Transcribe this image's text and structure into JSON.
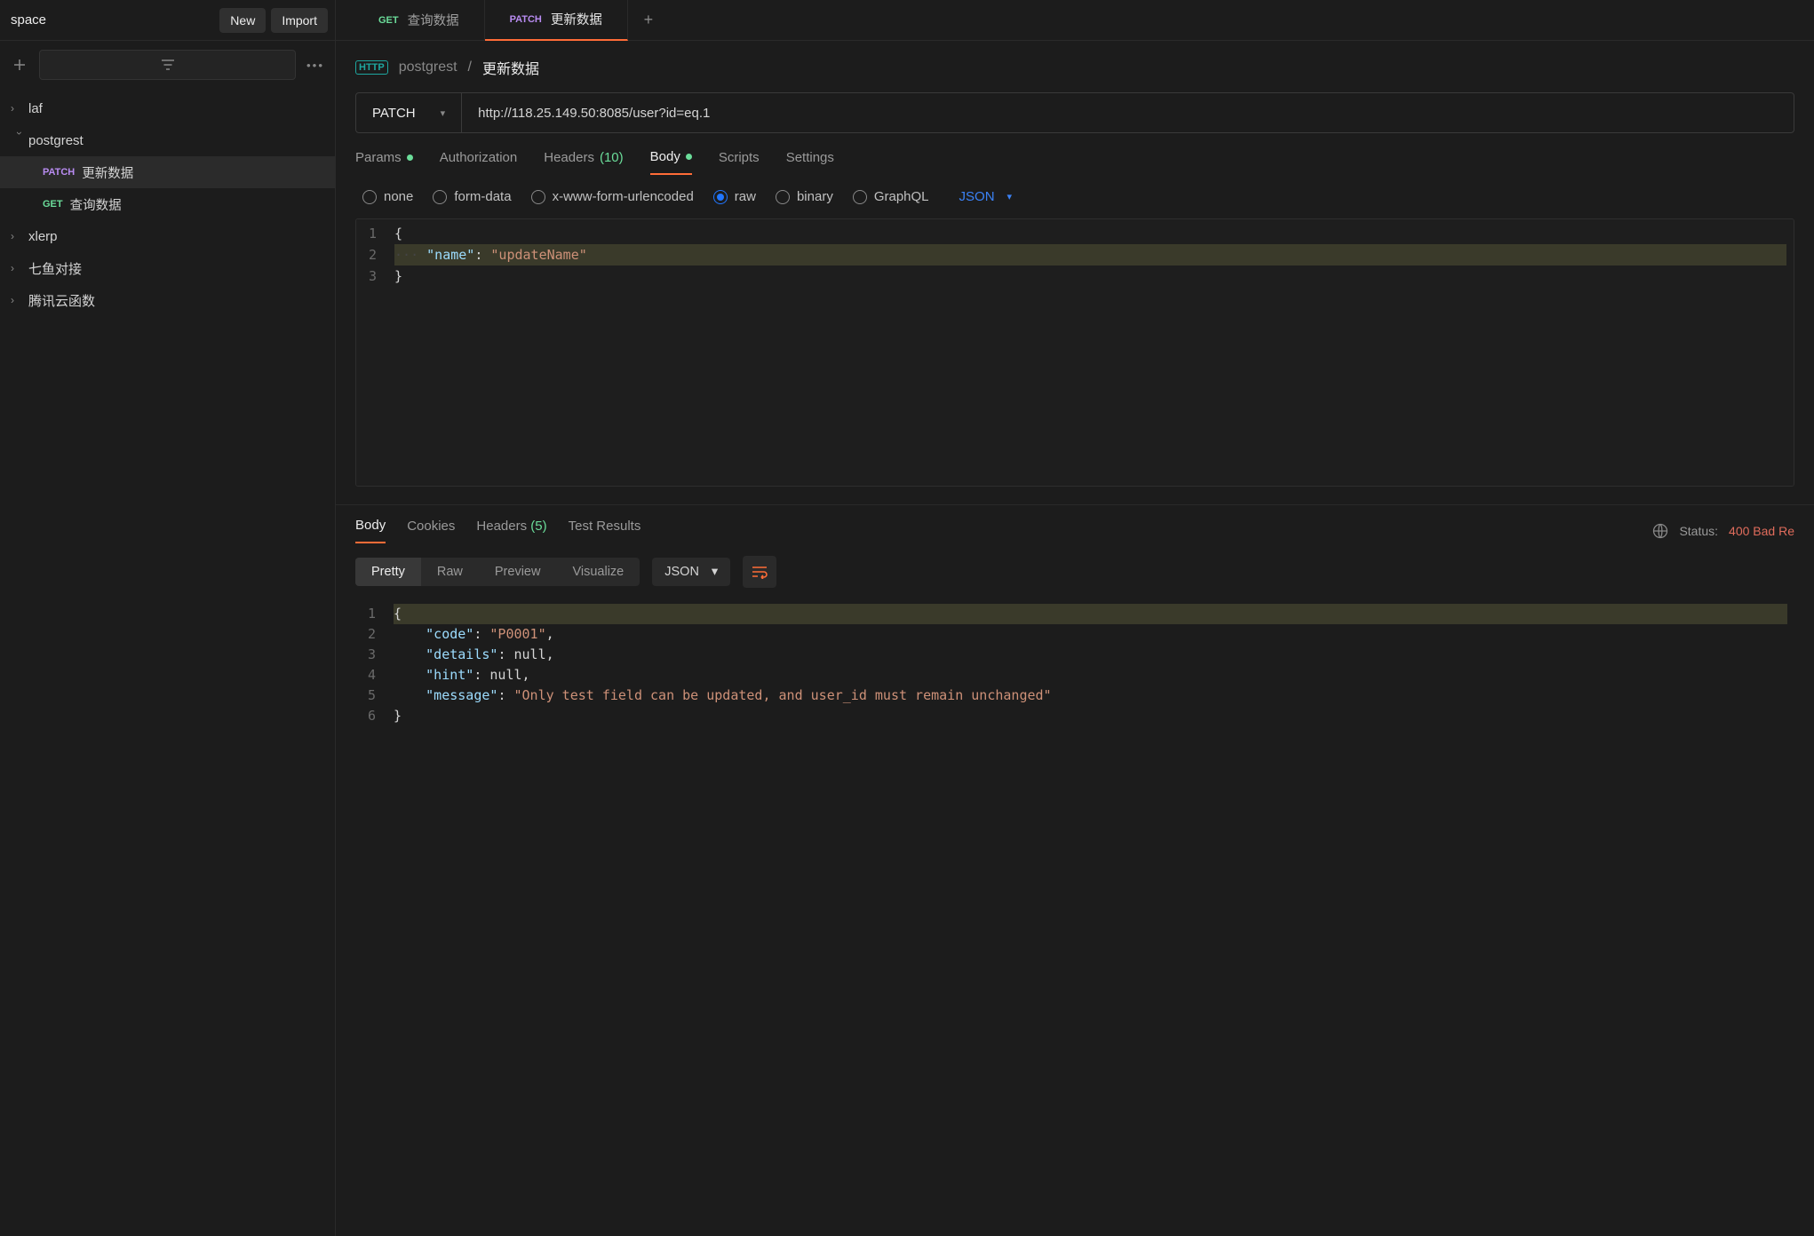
{
  "sidebar": {
    "workspace_label": "space",
    "new_btn": "New",
    "import_btn": "Import",
    "collections": [
      {
        "name": "laf",
        "expanded": false
      },
      {
        "name": "postgrest",
        "expanded": true,
        "children": [
          {
            "method": "PATCH",
            "name": "更新数据",
            "active": true
          },
          {
            "method": "GET",
            "name": "查询数据",
            "active": false
          }
        ]
      },
      {
        "name": "xlerp",
        "expanded": false
      },
      {
        "name": "七鱼对接",
        "expanded": false
      },
      {
        "name": "腾讯云函数",
        "expanded": false
      }
    ]
  },
  "tabs": [
    {
      "method": "GET",
      "label": "查询数据",
      "active": false
    },
    {
      "method": "PATCH",
      "label": "更新数据",
      "active": true
    }
  ],
  "breadcrumb": {
    "parent": "postgrest",
    "current": "更新数据"
  },
  "request": {
    "method": "PATCH",
    "url": "http://118.25.149.50:8085/user?id=eq.1",
    "tabs": {
      "params": "Params",
      "authorization": "Authorization",
      "headers": "Headers",
      "headers_count": "(10)",
      "body": "Body",
      "scripts": "Scripts",
      "settings": "Settings"
    },
    "body_types": {
      "none": "none",
      "form_data": "form-data",
      "xwww": "x-www-form-urlencoded",
      "raw": "raw",
      "binary": "binary",
      "graphql": "GraphQL"
    },
    "body_format": "JSON",
    "body_lines": {
      "l1": "{",
      "l2_key": "\"name\"",
      "l2_val": "\"updateName\"",
      "l3": "}"
    }
  },
  "response": {
    "tabs": {
      "body": "Body",
      "cookies": "Cookies",
      "headers": "Headers",
      "headers_count": "(5)",
      "test_results": "Test Results"
    },
    "status_label": "Status:",
    "status_value": "400 Bad Re",
    "view_modes": {
      "pretty": "Pretty",
      "raw": "Raw",
      "preview": "Preview",
      "visualize": "Visualize"
    },
    "format": "JSON",
    "body_lines": {
      "l1": "{",
      "l2_key": "\"code\"",
      "l2_val": "\"P0001\"",
      "l3_key": "\"details\"",
      "l3_val": "null",
      "l4_key": "\"hint\"",
      "l4_val": "null",
      "l5_key": "\"message\"",
      "l5_val": "\"Only test field can be updated, and user_id must remain unchanged\"",
      "l6": "}"
    }
  }
}
